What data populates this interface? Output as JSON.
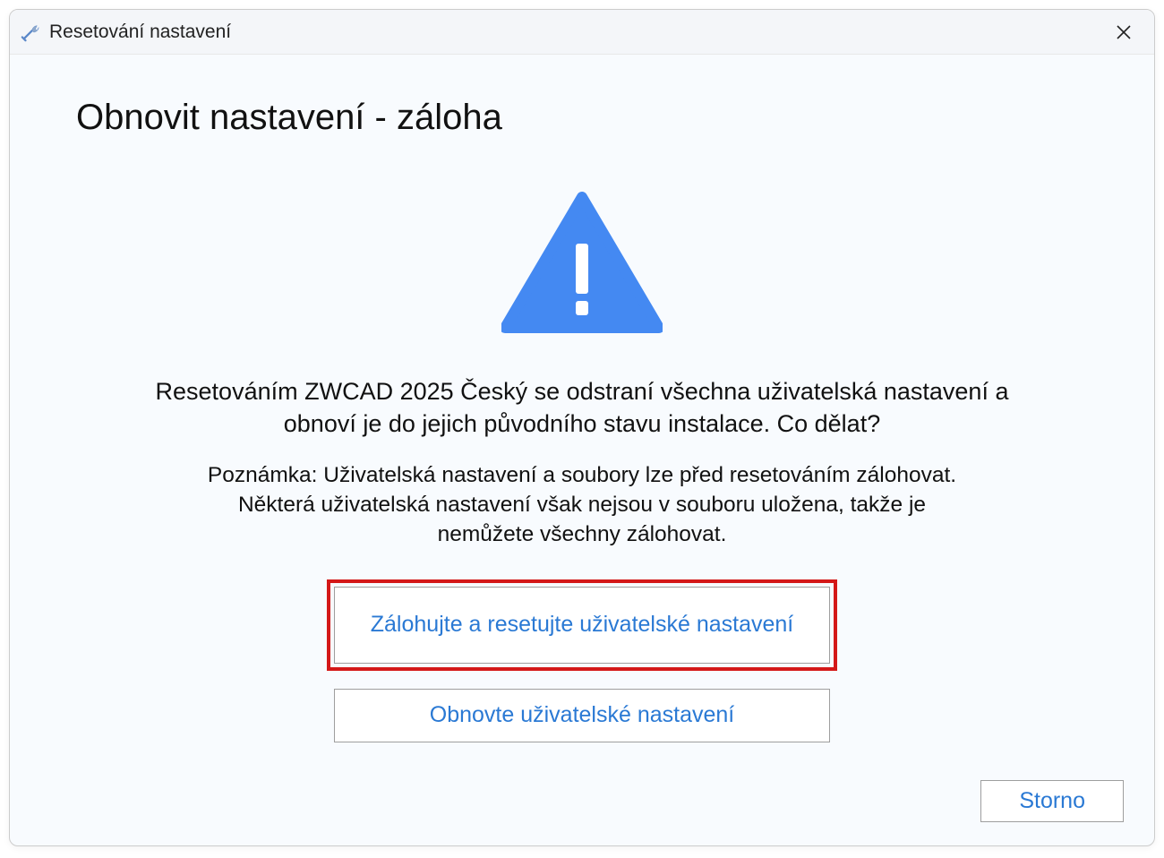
{
  "titlebar": {
    "title": "Resetování nastavení"
  },
  "dialog": {
    "heading": "Obnovit nastavení - záloha",
    "main_text": "Resetováním ZWCAD 2025 Český se odstraní všechna uživatelská nastavení a obnoví je do jejich původního stavu instalace. Co dělat?",
    "note_text": "Poznámka: Uživatelská nastavení a soubory lze před resetováním zálohovat. Některá uživatelská nastavení však nejsou v souboru uložena, takže je nemůžete všechny zálohovat.",
    "backup_reset_label": "Zálohujte a resetujte uživatelské nastavení",
    "reset_label": "Obnovte uživatelské nastavení",
    "cancel_label": "Storno"
  },
  "colors": {
    "accent_blue": "#4489f2",
    "link_blue": "#2a79d4",
    "highlight_red": "#d41818"
  }
}
